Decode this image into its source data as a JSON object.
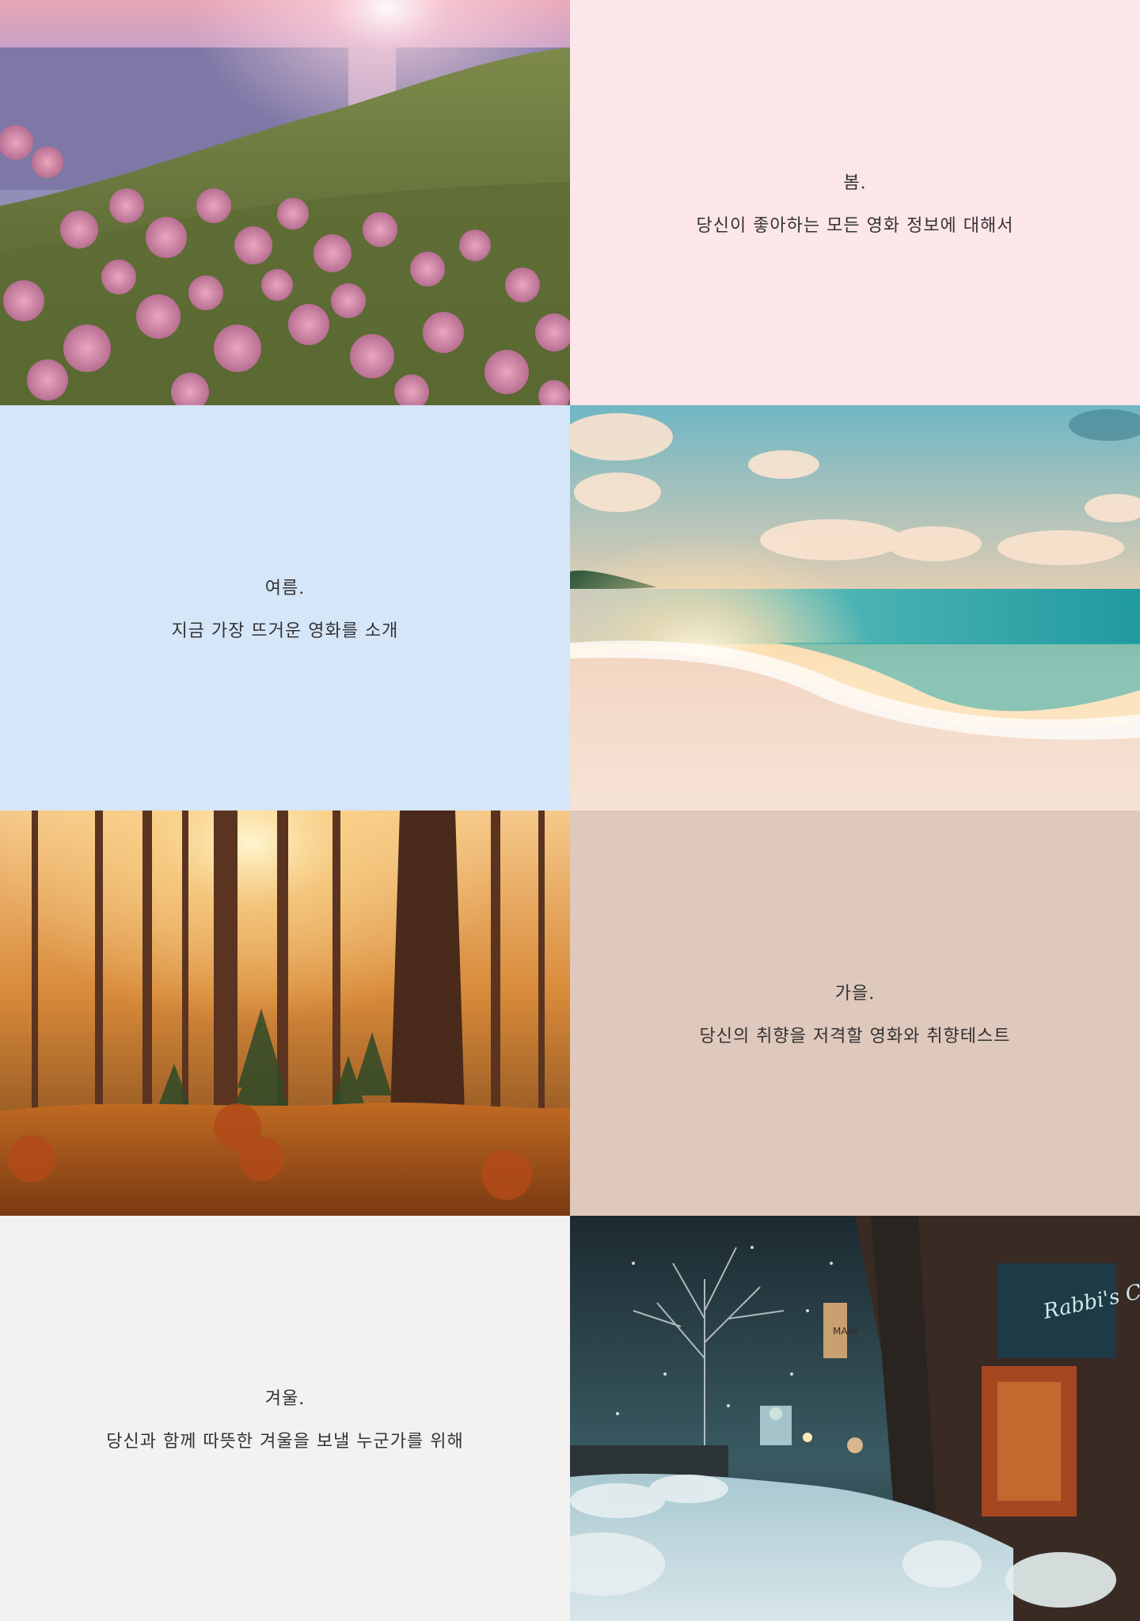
{
  "seasons": [
    {
      "title": "봄.",
      "subtitle": "당신이 좋아하는 모든 영화 정보에 대해서",
      "bg_color": "#fde6e9",
      "image": "pink-flowers-sea-sunset"
    },
    {
      "title": "여름.",
      "subtitle": "지금 가장 뜨거운 영화를 소개",
      "bg_color": "#d6e6f9",
      "image": "beach-sunset-waves"
    },
    {
      "title": "가을.",
      "subtitle": "당신의 취향을 저격할 영화와 취향테스트",
      "bg_color": "#dfc8bc",
      "image": "autumn-forest-sunbeams"
    },
    {
      "title": "겨울.",
      "subtitle": "당신과 함께 따뜻한 겨울을 보낼 누군가를 위해",
      "bg_color": "#f3f2f0",
      "image": "snowy-street-night"
    }
  ],
  "image_signs": {
    "winter_cafe": "Rabbi's Cafe",
    "winter_main": "MAIN"
  }
}
